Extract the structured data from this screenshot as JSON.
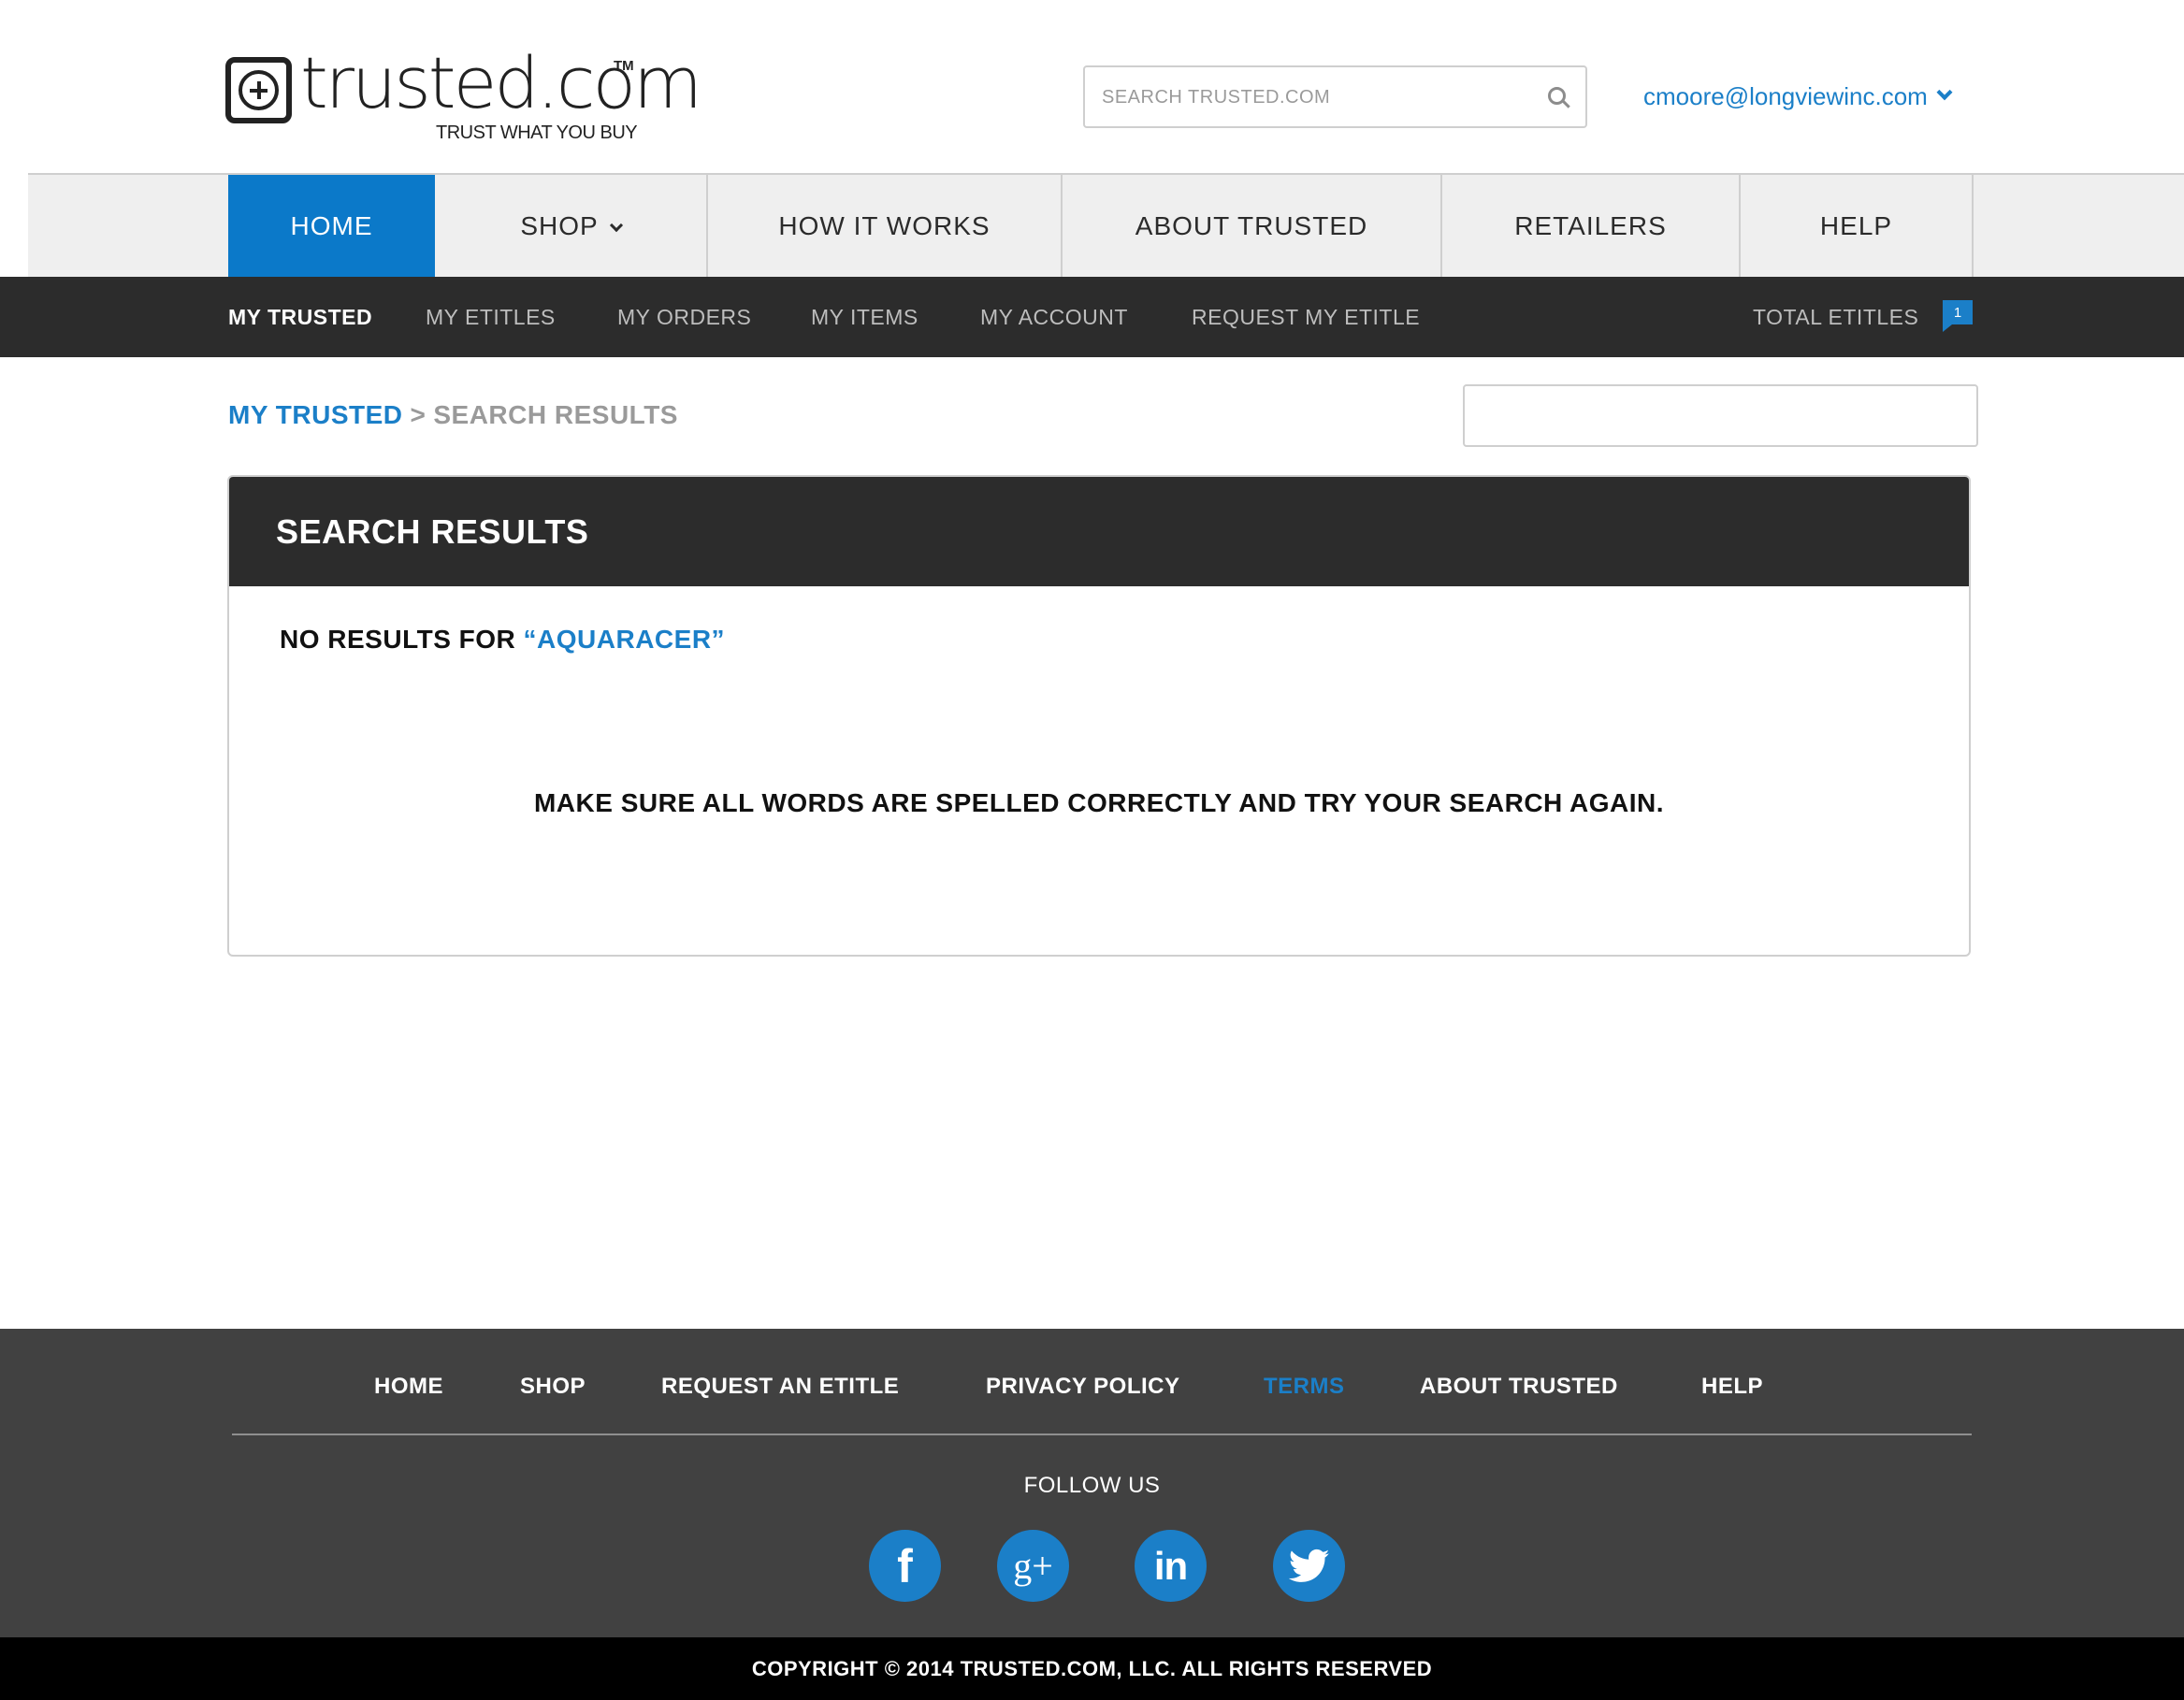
{
  "header": {
    "logo": {
      "wordmark": "trusted.com",
      "trademark": "TM",
      "tagline": "TRUST WHAT YOU BUY"
    },
    "search": {
      "placeholder": "SEARCH TRUSTED.COM",
      "value": "",
      "icon": "search-icon"
    },
    "user": {
      "email": "cmoore@longviewinc.com",
      "icon": "chevron-down-icon"
    }
  },
  "main_nav": {
    "items": [
      {
        "label": "HOME",
        "active": true
      },
      {
        "label": "SHOP",
        "has_dropdown": true
      },
      {
        "label": "HOW IT WORKS"
      },
      {
        "label": "ABOUT TRUSTED"
      },
      {
        "label": "RETAILERS"
      },
      {
        "label": "HELP"
      }
    ]
  },
  "sub_nav": {
    "items": [
      {
        "label": "MY TRUSTED",
        "active": true
      },
      {
        "label": "MY ETITLES"
      },
      {
        "label": "MY ORDERS"
      },
      {
        "label": "MY ITEMS"
      },
      {
        "label": "MY ACCOUNT"
      },
      {
        "label": "REQUEST MY ETITLE"
      }
    ],
    "total_etitles_label": "TOTAL ETITLES",
    "total_etitles_count": "1"
  },
  "breadcrumb": {
    "root": "MY TRUSTED",
    "separator": ">",
    "current": "SEARCH RESULTS"
  },
  "side_input": {
    "value": ""
  },
  "results": {
    "title": "SEARCH RESULTS",
    "no_results_prefix": "NO RESULTS FOR",
    "query": "“AQUARACER”",
    "hint": "MAKE SURE ALL WORDS ARE SPELLED CORRECTLY AND TRY YOUR SEARCH AGAIN."
  },
  "footer": {
    "links": [
      {
        "label": "HOME"
      },
      {
        "label": "SHOP"
      },
      {
        "label": "REQUEST AN ETITLE"
      },
      {
        "label": "PRIVACY POLICY"
      },
      {
        "label": "TERMS",
        "active": true
      },
      {
        "label": "ABOUT TRUSTED"
      },
      {
        "label": "HELP"
      }
    ],
    "follow_label": "FOLLOW US",
    "social": [
      {
        "icon": "facebook-icon",
        "glyph": "f"
      },
      {
        "icon": "google-plus-icon",
        "glyph": "g+"
      },
      {
        "icon": "linkedin-icon",
        "glyph": "in"
      },
      {
        "icon": "twitter-icon"
      }
    ],
    "copyright": "COPYRIGHT © 2014 TRUSTED.COM, LLC. ALL RIGHTS RESERVED"
  },
  "colors": {
    "brand_blue": "#1b7fc8",
    "nav_active": "#0b79c9",
    "dark_bar": "#2c2c2c",
    "footer_bg": "#414141",
    "copyright_bg": "#000000"
  }
}
